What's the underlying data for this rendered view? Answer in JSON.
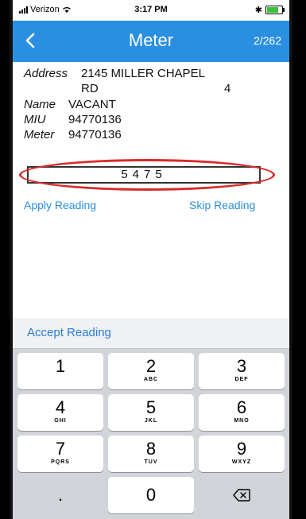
{
  "status_bar": {
    "carrier": "Verizon",
    "time": "3:17 PM"
  },
  "nav": {
    "back_icon": "chevron-left-icon",
    "title": "Meter",
    "count": "2/262"
  },
  "meter": {
    "address_label": "Address",
    "address_line1": "2145 MILLER CHAPEL",
    "address_line2": "RD",
    "address_number": "4",
    "name_label": "Name",
    "name_value": "VACANT",
    "miu_label": "MIU",
    "miu_value": "94770136",
    "meter_label": "Meter",
    "meter_value": "94770136",
    "reading_value": "5475"
  },
  "actions": {
    "apply": "Apply Reading",
    "skip": "Skip Reading",
    "accept": "Accept Reading"
  },
  "keypad": [
    {
      "num": "1",
      "sub": ""
    },
    {
      "num": "2",
      "sub": "ABC"
    },
    {
      "num": "3",
      "sub": "DEF"
    },
    {
      "num": "4",
      "sub": "GHI"
    },
    {
      "num": "5",
      "sub": "JKL"
    },
    {
      "num": "6",
      "sub": "MNO"
    },
    {
      "num": "7",
      "sub": "PQRS"
    },
    {
      "num": "8",
      "sub": "TUV"
    },
    {
      "num": "9",
      "sub": "WXYZ"
    },
    {
      "num": ".",
      "sub": ""
    },
    {
      "num": "0",
      "sub": ""
    },
    {
      "num": "⌫",
      "sub": ""
    }
  ],
  "colors": {
    "accent": "#2a8fe0",
    "highlight": "#d92b2b",
    "keyboard_bg": "#d1d4d9"
  }
}
